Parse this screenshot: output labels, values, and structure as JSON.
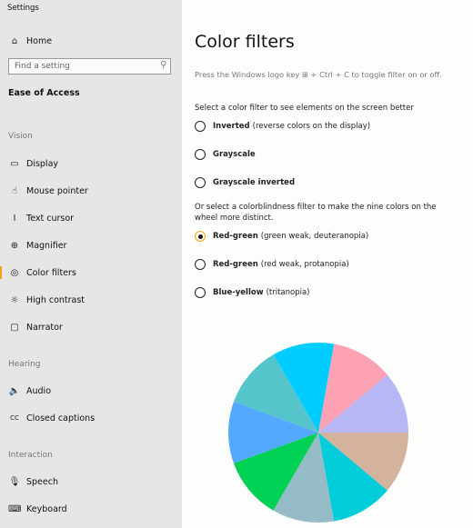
{
  "app_title": "Settings",
  "sidebar": {
    "home_label": "Home",
    "search_placeholder": "Find a setting",
    "category": "Ease of Access",
    "sections": [
      {
        "title": "Vision",
        "items": [
          {
            "label": "Display",
            "icon": "display-icon"
          },
          {
            "label": "Mouse pointer",
            "icon": "mouse-pointer-icon"
          },
          {
            "label": "Text cursor",
            "icon": "text-cursor-icon"
          },
          {
            "label": "Magnifier",
            "icon": "magnifier-icon"
          },
          {
            "label": "Color filters",
            "icon": "color-filters-icon",
            "active": true
          },
          {
            "label": "High contrast",
            "icon": "high-contrast-icon"
          },
          {
            "label": "Narrator",
            "icon": "narrator-icon"
          }
        ]
      },
      {
        "title": "Hearing",
        "items": [
          {
            "label": "Audio",
            "icon": "audio-icon"
          },
          {
            "label": "Closed captions",
            "icon": "closed-captions-icon"
          }
        ]
      },
      {
        "title": "Interaction",
        "items": [
          {
            "label": "Speech",
            "icon": "speech-icon"
          },
          {
            "label": "Keyboard",
            "icon": "keyboard-icon"
          }
        ]
      }
    ]
  },
  "main": {
    "title": "Color filters",
    "hint": "Press the Windows logo key ⊞ + Ctrl + C to toggle filter on or off.",
    "filter_prompt": "Select a color filter to see elements on the screen better",
    "filters": [
      {
        "name": "Inverted",
        "desc": "(reverse colors on the display)",
        "checked": false
      },
      {
        "name": "Grayscale",
        "desc": "",
        "checked": false
      },
      {
        "name": "Grayscale inverted",
        "desc": "",
        "checked": false
      }
    ],
    "colorblind_prompt": "Or select a colorblindness filter to make the nine colors on the wheel more distinct.",
    "colorblind_filters": [
      {
        "name": "Red-green",
        "desc": "(green weak, deuteranopia)",
        "checked": true
      },
      {
        "name": "Red-green",
        "desc": "(red weak, protanopia)",
        "checked": false
      },
      {
        "name": "Blue-yellow",
        "desc": "(tritanopia)",
        "checked": false
      }
    ],
    "accent_color": "#f7a21b",
    "wheel_colors": [
      "#b7b7f5",
      "#fda2b5",
      "#00ccff",
      "#56c4cb",
      "#53a9fd",
      "#00d054",
      "#95bbc6",
      "#00ccda",
      "#d3b39e"
    ]
  }
}
